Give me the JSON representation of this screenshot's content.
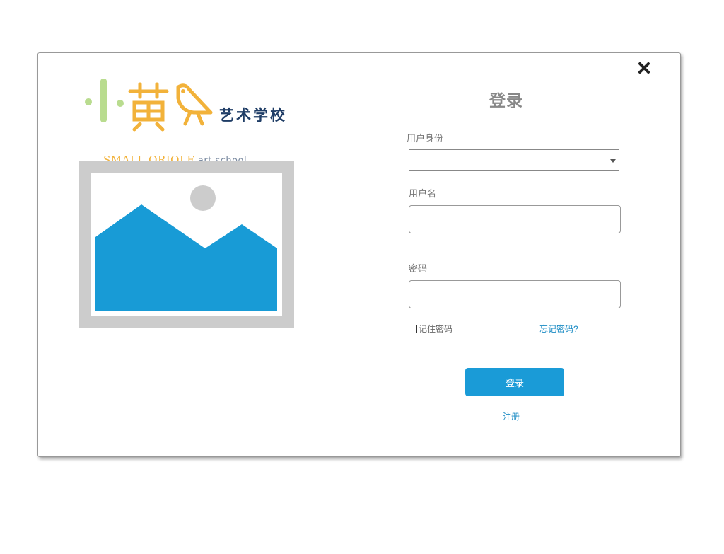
{
  "logo": {
    "chinese_name": "艺术学校",
    "english_name": "SMALL ORIOLE",
    "english_sub": "art school",
    "colors": {
      "green": "#b9dc8f",
      "yellow": "#f2b23a",
      "navy": "#1f3d66"
    }
  },
  "image_placeholder": {
    "icon": "image-placeholder-icon",
    "colors": {
      "frame": "#cccccc",
      "mountains": "#189bd6",
      "sun": "#cccccc"
    }
  },
  "close_button": {
    "icon": "close-icon"
  },
  "form": {
    "title": "登录",
    "identity_label": "用户身份",
    "identity_value": "",
    "username_label": "用户名",
    "username_value": "",
    "password_label": "密码",
    "password_value": "",
    "remember_label": "记住密码",
    "remember_checked": false,
    "forgot_link": "忘记密码?",
    "login_button": "登录",
    "register_link": "注册"
  },
  "colors": {
    "accent": "#1a9bd7",
    "link": "#1a8bc4",
    "border": "#999999"
  }
}
